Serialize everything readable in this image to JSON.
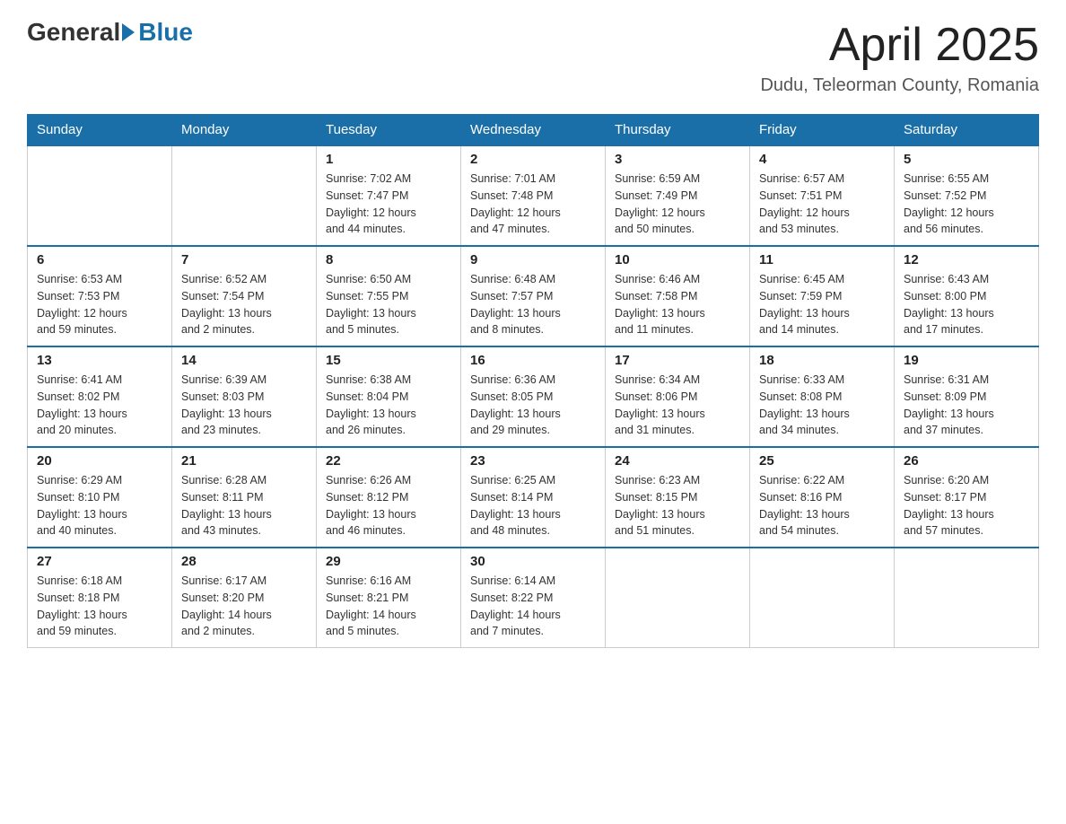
{
  "logo": {
    "general": "General",
    "blue": "Blue"
  },
  "title": "April 2025",
  "subtitle": "Dudu, Teleorman County, Romania",
  "header_days": [
    "Sunday",
    "Monday",
    "Tuesday",
    "Wednesday",
    "Thursday",
    "Friday",
    "Saturday"
  ],
  "weeks": [
    [
      {
        "day": "",
        "info": ""
      },
      {
        "day": "",
        "info": ""
      },
      {
        "day": "1",
        "info": "Sunrise: 7:02 AM\nSunset: 7:47 PM\nDaylight: 12 hours\nand 44 minutes."
      },
      {
        "day": "2",
        "info": "Sunrise: 7:01 AM\nSunset: 7:48 PM\nDaylight: 12 hours\nand 47 minutes."
      },
      {
        "day": "3",
        "info": "Sunrise: 6:59 AM\nSunset: 7:49 PM\nDaylight: 12 hours\nand 50 minutes."
      },
      {
        "day": "4",
        "info": "Sunrise: 6:57 AM\nSunset: 7:51 PM\nDaylight: 12 hours\nand 53 minutes."
      },
      {
        "day": "5",
        "info": "Sunrise: 6:55 AM\nSunset: 7:52 PM\nDaylight: 12 hours\nand 56 minutes."
      }
    ],
    [
      {
        "day": "6",
        "info": "Sunrise: 6:53 AM\nSunset: 7:53 PM\nDaylight: 12 hours\nand 59 minutes."
      },
      {
        "day": "7",
        "info": "Sunrise: 6:52 AM\nSunset: 7:54 PM\nDaylight: 13 hours\nand 2 minutes."
      },
      {
        "day": "8",
        "info": "Sunrise: 6:50 AM\nSunset: 7:55 PM\nDaylight: 13 hours\nand 5 minutes."
      },
      {
        "day": "9",
        "info": "Sunrise: 6:48 AM\nSunset: 7:57 PM\nDaylight: 13 hours\nand 8 minutes."
      },
      {
        "day": "10",
        "info": "Sunrise: 6:46 AM\nSunset: 7:58 PM\nDaylight: 13 hours\nand 11 minutes."
      },
      {
        "day": "11",
        "info": "Sunrise: 6:45 AM\nSunset: 7:59 PM\nDaylight: 13 hours\nand 14 minutes."
      },
      {
        "day": "12",
        "info": "Sunrise: 6:43 AM\nSunset: 8:00 PM\nDaylight: 13 hours\nand 17 minutes."
      }
    ],
    [
      {
        "day": "13",
        "info": "Sunrise: 6:41 AM\nSunset: 8:02 PM\nDaylight: 13 hours\nand 20 minutes."
      },
      {
        "day": "14",
        "info": "Sunrise: 6:39 AM\nSunset: 8:03 PM\nDaylight: 13 hours\nand 23 minutes."
      },
      {
        "day": "15",
        "info": "Sunrise: 6:38 AM\nSunset: 8:04 PM\nDaylight: 13 hours\nand 26 minutes."
      },
      {
        "day": "16",
        "info": "Sunrise: 6:36 AM\nSunset: 8:05 PM\nDaylight: 13 hours\nand 29 minutes."
      },
      {
        "day": "17",
        "info": "Sunrise: 6:34 AM\nSunset: 8:06 PM\nDaylight: 13 hours\nand 31 minutes."
      },
      {
        "day": "18",
        "info": "Sunrise: 6:33 AM\nSunset: 8:08 PM\nDaylight: 13 hours\nand 34 minutes."
      },
      {
        "day": "19",
        "info": "Sunrise: 6:31 AM\nSunset: 8:09 PM\nDaylight: 13 hours\nand 37 minutes."
      }
    ],
    [
      {
        "day": "20",
        "info": "Sunrise: 6:29 AM\nSunset: 8:10 PM\nDaylight: 13 hours\nand 40 minutes."
      },
      {
        "day": "21",
        "info": "Sunrise: 6:28 AM\nSunset: 8:11 PM\nDaylight: 13 hours\nand 43 minutes."
      },
      {
        "day": "22",
        "info": "Sunrise: 6:26 AM\nSunset: 8:12 PM\nDaylight: 13 hours\nand 46 minutes."
      },
      {
        "day": "23",
        "info": "Sunrise: 6:25 AM\nSunset: 8:14 PM\nDaylight: 13 hours\nand 48 minutes."
      },
      {
        "day": "24",
        "info": "Sunrise: 6:23 AM\nSunset: 8:15 PM\nDaylight: 13 hours\nand 51 minutes."
      },
      {
        "day": "25",
        "info": "Sunrise: 6:22 AM\nSunset: 8:16 PM\nDaylight: 13 hours\nand 54 minutes."
      },
      {
        "day": "26",
        "info": "Sunrise: 6:20 AM\nSunset: 8:17 PM\nDaylight: 13 hours\nand 57 minutes."
      }
    ],
    [
      {
        "day": "27",
        "info": "Sunrise: 6:18 AM\nSunset: 8:18 PM\nDaylight: 13 hours\nand 59 minutes."
      },
      {
        "day": "28",
        "info": "Sunrise: 6:17 AM\nSunset: 8:20 PM\nDaylight: 14 hours\nand 2 minutes."
      },
      {
        "day": "29",
        "info": "Sunrise: 6:16 AM\nSunset: 8:21 PM\nDaylight: 14 hours\nand 5 minutes."
      },
      {
        "day": "30",
        "info": "Sunrise: 6:14 AM\nSunset: 8:22 PM\nDaylight: 14 hours\nand 7 minutes."
      },
      {
        "day": "",
        "info": ""
      },
      {
        "day": "",
        "info": ""
      },
      {
        "day": "",
        "info": ""
      }
    ]
  ]
}
